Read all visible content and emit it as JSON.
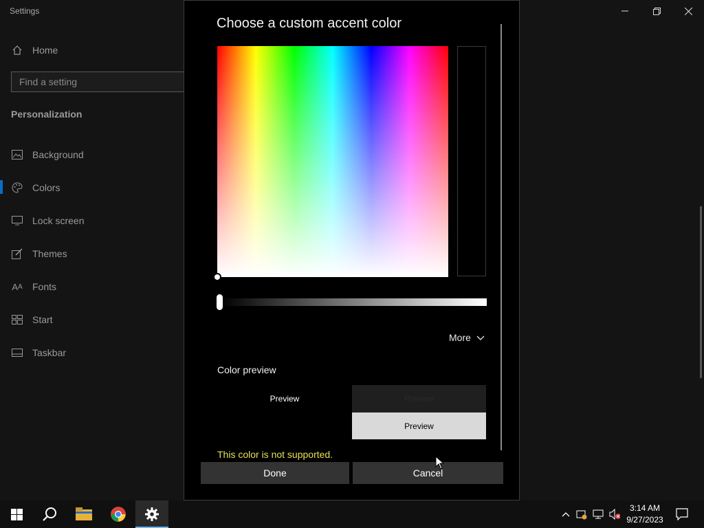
{
  "window": {
    "title": "Settings",
    "controls": [
      "minimize",
      "restore",
      "close"
    ]
  },
  "sidebar": {
    "home_label": "Home",
    "search_placeholder": "Find a setting",
    "section_title": "Personalization",
    "items": [
      {
        "label": "Background",
        "icon": "image-icon"
      },
      {
        "label": "Colors",
        "icon": "palette-icon",
        "selected": true
      },
      {
        "label": "Lock screen",
        "icon": "lock-screen-icon"
      },
      {
        "label": "Themes",
        "icon": "themes-icon"
      },
      {
        "label": "Fonts",
        "icon": "fonts-icon"
      },
      {
        "label": "Start",
        "icon": "start-icon"
      },
      {
        "label": "Taskbar",
        "icon": "taskbar-icon"
      }
    ]
  },
  "dialog": {
    "title": "Choose a custom accent color",
    "more_label": "More",
    "color_preview_label": "Color preview",
    "preview_dark_label": "Preview",
    "preview_black_label": "Preview",
    "preview_light_label": "Preview",
    "warning": "This color is not supported.",
    "done_label": "Done",
    "cancel_label": "Cancel",
    "selected_color": "#000000"
  },
  "taskbar": {
    "time": "3:14 AM",
    "date": "9/27/2023",
    "apps": [
      "start",
      "search",
      "file-explorer",
      "chrome",
      "settings"
    ]
  },
  "colors": {
    "accent": "#0b6cc4",
    "warning": "#e8e05a",
    "taskbar_indicator": "#6fb6f0"
  }
}
